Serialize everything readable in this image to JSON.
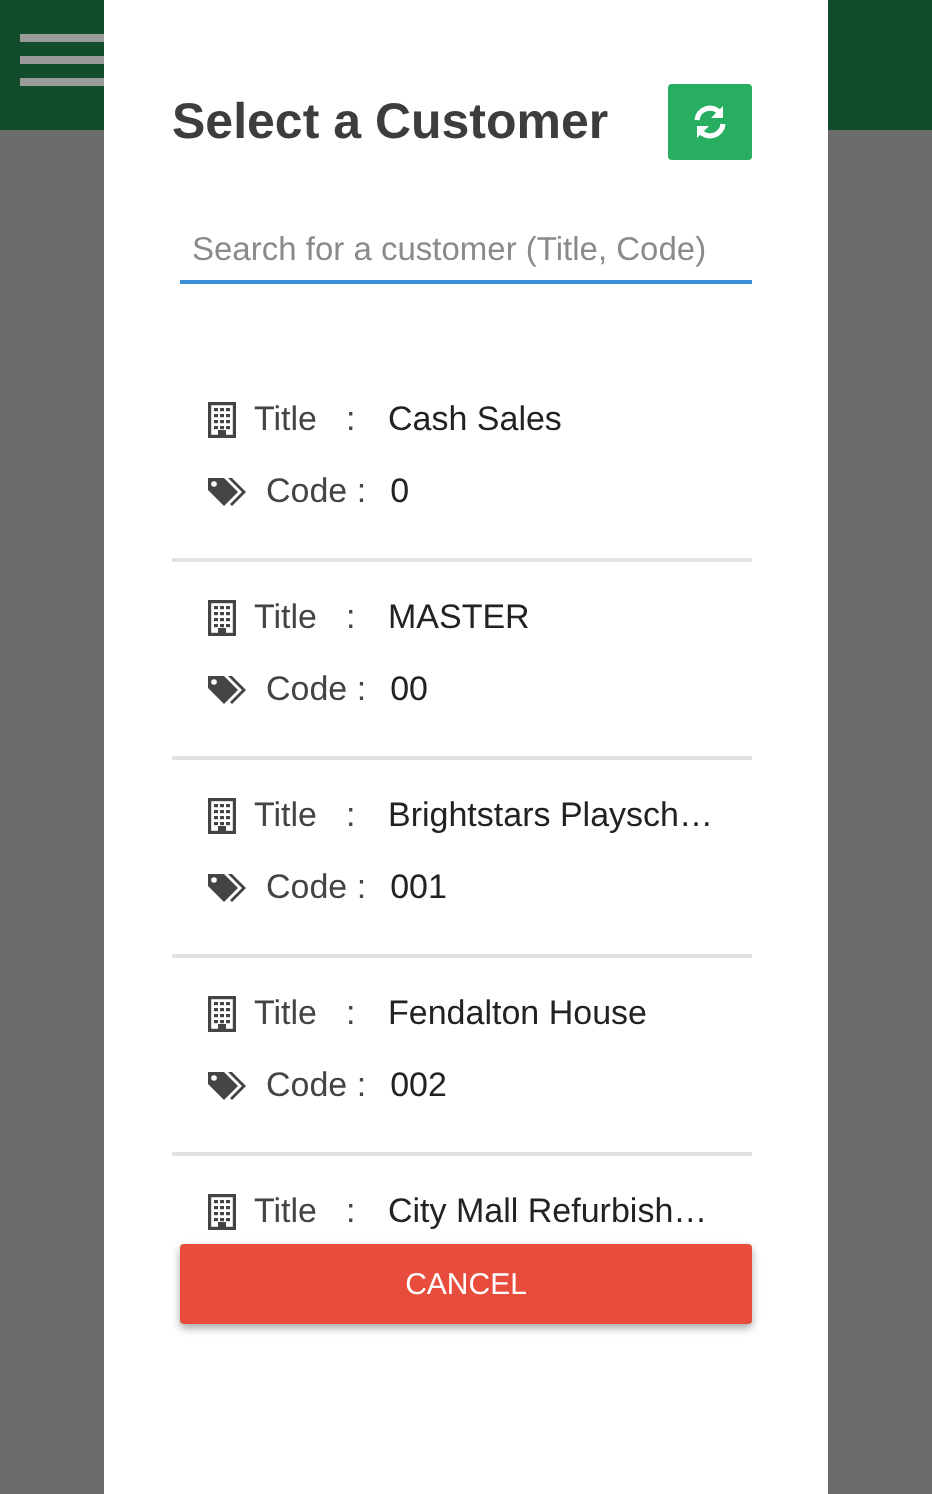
{
  "dialog": {
    "title": "Select a Customer",
    "search": {
      "placeholder": "Search for a customer (Title, Code)"
    },
    "customers": [
      {
        "title_label": "Title",
        "title_sep": ":",
        "title": "Cash Sales",
        "code_label": "Code :",
        "code": "0"
      },
      {
        "title_label": "Title",
        "title_sep": ":",
        "title": "MASTER",
        "code_label": "Code :",
        "code": "00"
      },
      {
        "title_label": "Title",
        "title_sep": ":",
        "title": "Brightstars Playsch…",
        "code_label": "Code :",
        "code": "001"
      },
      {
        "title_label": "Title",
        "title_sep": ":",
        "title": "Fendalton House",
        "code_label": "Code :",
        "code": "002"
      },
      {
        "title_label": "Title",
        "title_sep": ":",
        "title": "City Mall Refurbish…"
      }
    ],
    "cancel": "CANCEL"
  }
}
